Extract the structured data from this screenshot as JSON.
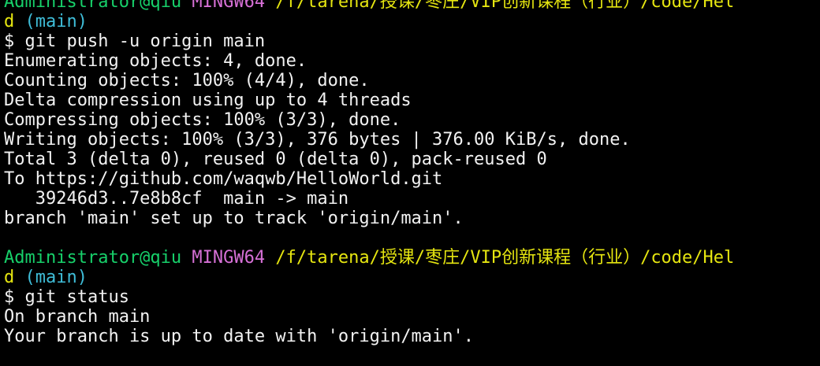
{
  "colors": {
    "background": "#000000",
    "foreground": "#f2f2f2",
    "user_host": "#17d06a",
    "msystem": "#d670d6",
    "path": "#e5e510",
    "branch": "#3fbdd8"
  },
  "prompts": [
    {
      "user_host": "Administrator@qiu",
      "msystem": "MINGW64",
      "path": "/f/tarena/授课/枣庄/VIP创新课程（行业）/code/Hel",
      "path_wrap": "d",
      "branch": "(main)",
      "command": "$ git push -u origin main"
    },
    {
      "user_host": "Administrator@qiu",
      "msystem": "MINGW64",
      "path": "/f/tarena/授课/枣庄/VIP创新课程（行业）/code/Hel",
      "path_wrap": "d",
      "branch": "(main)",
      "command": "$ git status"
    }
  ],
  "push_output": [
    "Enumerating objects: 4, done.",
    "Counting objects: 100% (4/4), done.",
    "Delta compression using up to 4 threads",
    "Compressing objects: 100% (3/3), done.",
    "Writing objects: 100% (3/3), 376 bytes | 376.00 KiB/s, done.",
    "Total 3 (delta 0), reused 0 (delta 0), pack-reused 0",
    "To https://github.com/waqwb/HelloWorld.git",
    "   39246d3..7e8b8cf  main -> main",
    "branch 'main' set up to track 'origin/main'."
  ],
  "status_output": [
    "On branch main",
    "Your branch is up to date with 'origin/main'."
  ]
}
